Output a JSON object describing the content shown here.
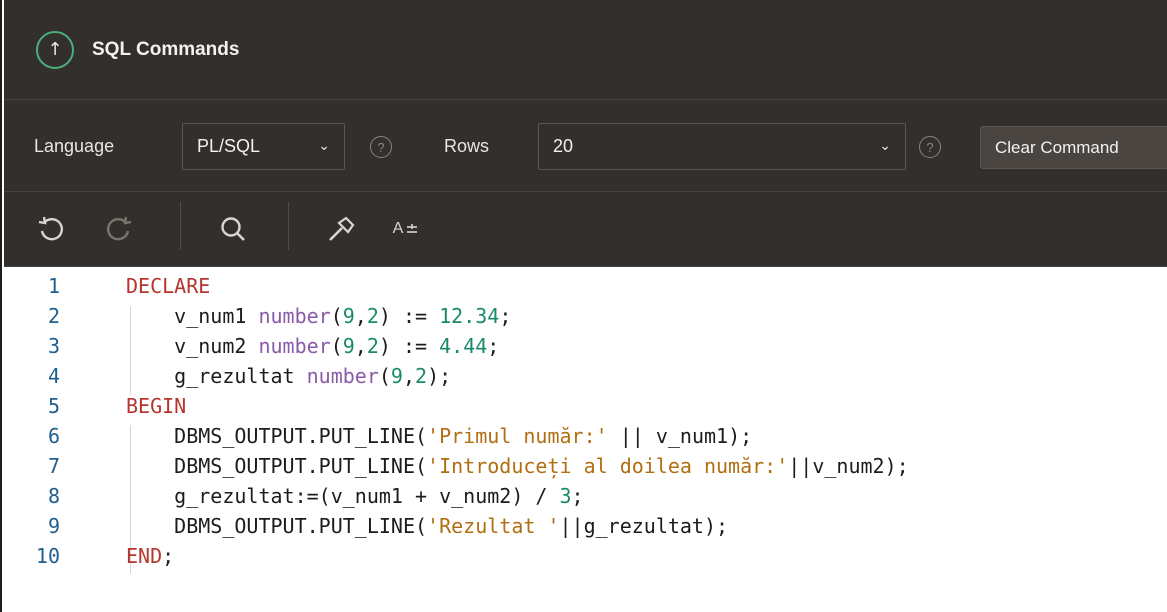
{
  "header": {
    "title": "SQL Commands",
    "collapse_icon": "↑"
  },
  "settings": {
    "language_label": "Language",
    "language_value": "PL/SQL",
    "rows_label": "Rows",
    "rows_value": "20",
    "help_glyph": "?",
    "clear_button": "Clear Command"
  },
  "toolbar": {
    "items": [
      "undo-icon",
      "redo-icon",
      "search-icon",
      "build-icon",
      "font-size-icon"
    ],
    "font_size_label": "A"
  },
  "editor": {
    "line_numbers": [
      "1",
      "2",
      "3",
      "4",
      "5",
      "6",
      "7",
      "8",
      "9",
      "10"
    ],
    "lines": [
      [
        {
          "t": "DECLARE",
          "c": "kw"
        }
      ],
      [
        {
          "t": "    v_num1 ",
          "c": ""
        },
        {
          "t": "number",
          "c": "ty"
        },
        {
          "t": "(",
          "c": ""
        },
        {
          "t": "9",
          "c": "num"
        },
        {
          "t": ",",
          "c": ""
        },
        {
          "t": "2",
          "c": "num"
        },
        {
          "t": ") := ",
          "c": ""
        },
        {
          "t": "12.34",
          "c": "num"
        },
        {
          "t": ";",
          "c": ""
        }
      ],
      [
        {
          "t": "    v_num2 ",
          "c": ""
        },
        {
          "t": "number",
          "c": "ty"
        },
        {
          "t": "(",
          "c": ""
        },
        {
          "t": "9",
          "c": "num"
        },
        {
          "t": ",",
          "c": ""
        },
        {
          "t": "2",
          "c": "num"
        },
        {
          "t": ") := ",
          "c": ""
        },
        {
          "t": "4.44",
          "c": "num"
        },
        {
          "t": ";",
          "c": ""
        }
      ],
      [
        {
          "t": "    g_rezultat ",
          "c": ""
        },
        {
          "t": "number",
          "c": "ty"
        },
        {
          "t": "(",
          "c": ""
        },
        {
          "t": "9",
          "c": "num"
        },
        {
          "t": ",",
          "c": ""
        },
        {
          "t": "2",
          "c": "num"
        },
        {
          "t": ");",
          "c": ""
        }
      ],
      [
        {
          "t": "BEGIN",
          "c": "kw"
        }
      ],
      [
        {
          "t": "    DBMS_OUTPUT.PUT_LINE(",
          "c": ""
        },
        {
          "t": "'Primul număr:'",
          "c": "str"
        },
        {
          "t": " || v_num1);",
          "c": ""
        }
      ],
      [
        {
          "t": "    DBMS_OUTPUT.PUT_LINE(",
          "c": ""
        },
        {
          "t": "'Introduceți al doilea număr:'",
          "c": "str"
        },
        {
          "t": "||v_num2);",
          "c": ""
        }
      ],
      [
        {
          "t": "    g_rezultat:=(v_num1 + v_num2) / ",
          "c": ""
        },
        {
          "t": "3",
          "c": "num"
        },
        {
          "t": ";",
          "c": ""
        }
      ],
      [
        {
          "t": "    DBMS_OUTPUT.PUT_LINE(",
          "c": ""
        },
        {
          "t": "'Rezultat '",
          "c": "str"
        },
        {
          "t": "||g_rezultat);",
          "c": ""
        }
      ],
      [
        {
          "t": "END",
          "c": "kw"
        },
        {
          "t": ";",
          "c": ""
        }
      ]
    ]
  }
}
